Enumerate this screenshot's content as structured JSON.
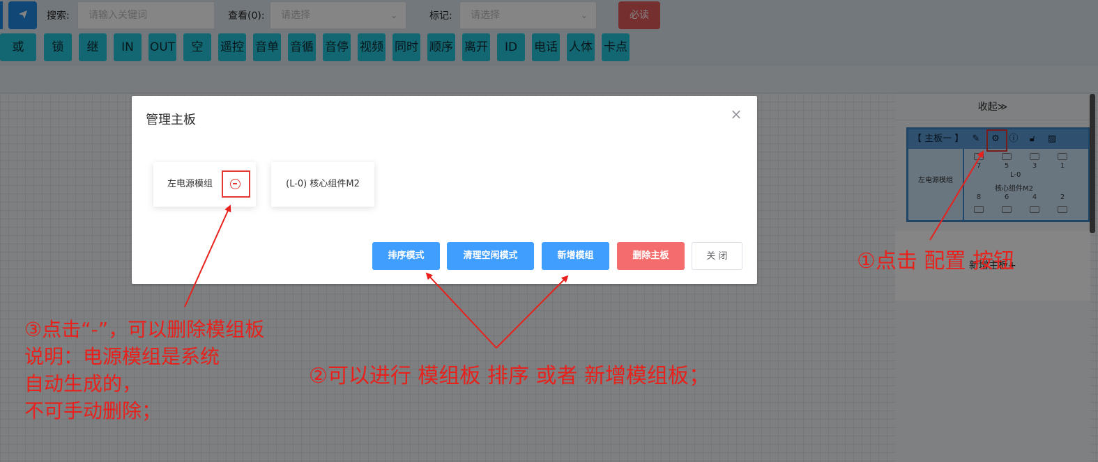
{
  "toolbar": {
    "search_label": "搜索:",
    "search_placeholder": "请输入关键词",
    "view_label": "查看(0):",
    "view_placeholder": "请选择",
    "mark_label": "标记:",
    "mark_placeholder": "请选择",
    "must_read_label": "必读"
  },
  "chips": [
    "或",
    "锁",
    "继",
    "IN",
    "OUT",
    "空",
    "遥控",
    "音单",
    "音循",
    "音停",
    "视频",
    "同时",
    "顺序",
    "离开",
    "ID",
    "电话",
    "人体",
    "卡点"
  ],
  "right_panel": {
    "collapse_label": "收起≫",
    "board_title": "【 主板一 】",
    "left_module": "左电源模组",
    "mid_label": "L-0",
    "mid_name": "核心组件M2",
    "top_slots": [
      "7",
      "5",
      "3",
      "1"
    ],
    "bottom_slots": [
      "8",
      "6",
      "4",
      "2"
    ],
    "new_board": "新增主板+"
  },
  "dialog": {
    "title": "管理主板",
    "modules": [
      "左电源模组",
      "(L-0) 核心组件M2"
    ],
    "buttons": {
      "sort": "排序模式",
      "clear_idle": "清理空闲模式",
      "add_module": "新增模组",
      "delete_board": "删除主板",
      "close": "关 闭"
    }
  },
  "annotations": {
    "step1": "①点击 配置 按钮",
    "step2": "②可以进行 模组板 排序 或者 新增模组板；",
    "step3_line1": "③点击“-”，可以删除模组板",
    "step3_line2": "说明：电源模组是系统",
    "step3_line3": "自动生成的，",
    "step3_line4": "不可手动删除；"
  },
  "colors": {
    "annotation_red": "#e8211c",
    "primary_blue": "#409eff",
    "danger_red": "#f56c6c",
    "chip_cyan": "#26c6da"
  },
  "icons": [
    "send-icon",
    "chevron-down-icon",
    "edit-icon",
    "gear-icon",
    "info-icon",
    "unlock-icon",
    "image-icon",
    "close-icon",
    "minus-circle-icon"
  ]
}
